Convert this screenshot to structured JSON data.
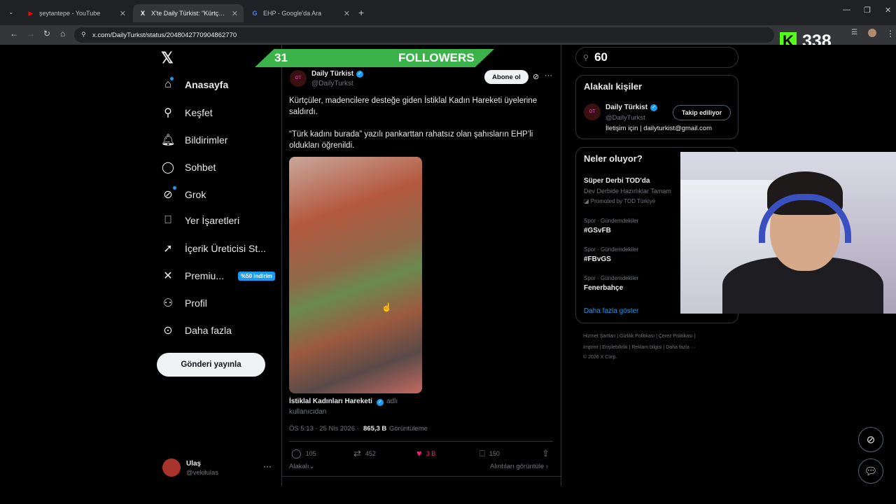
{
  "browser": {
    "tabs": [
      {
        "title": "şeytantepe - YouTube",
        "favicon": "youtube-icon",
        "active": false
      },
      {
        "title": "X'te Daily Türkist: \"Kürtçüler, m",
        "favicon": "x-icon",
        "active": true
      },
      {
        "title": "EHP - Google'da Ara",
        "favicon": "google-icon",
        "active": false
      }
    ],
    "url": "x.com/DailyTurkst/status/2048042770904862770"
  },
  "overlay": {
    "followers_count": "31",
    "followers_label": "FOLLOWERS",
    "kick_viewers": "338",
    "kick_logo_letter": "K"
  },
  "sidebar": {
    "items": [
      {
        "label": "Anasayfa",
        "icon": "home-icon"
      },
      {
        "label": "Keşfet",
        "icon": "search-icon"
      },
      {
        "label": "Bildirimler",
        "icon": "bell-icon"
      },
      {
        "label": "Sohbet",
        "icon": "chat-icon"
      },
      {
        "label": "Grok",
        "icon": "grok-icon"
      },
      {
        "label": "Yer İşaretleri",
        "icon": "bookmark-icon"
      },
      {
        "label": "İçerik Üreticisi St...",
        "icon": "rocket-icon"
      },
      {
        "label": "Premiu...",
        "icon": "x-premium-icon",
        "badge": "%50 indirim"
      },
      {
        "label": "Profil",
        "icon": "person-icon"
      },
      {
        "label": "Daha fazla",
        "icon": "more-circle-icon"
      }
    ],
    "post_button": "Gönderi yayınla",
    "user": {
      "name": "Ulaş",
      "handle": "@vekilulas"
    }
  },
  "tweet": {
    "author_name": "Daily Türkist",
    "author_handle": "@DailyTurkst",
    "subscribe_label": "Abone ol",
    "text_1": "Kürtçüler, madencilere desteğe giden İstiklal Kadın Hareketi üyelerine",
    "text_1b": "saldırdı.",
    "text_2": "“Türk kadını burada” yazılı pankarttan rahatsız olan şahısların EHP’li",
    "text_2b": "oldukları öğrenildi.",
    "source_name": "İstiklal Kadınları Hareketi",
    "source_suffix": "adlı",
    "source_suffix_2": "kullanıcıdan",
    "time": "ÖS 5:13 · 25 Nis 2026 ·",
    "views_count": "865,3 B",
    "views_label": "Görüntüleme",
    "actions": {
      "replies": "105",
      "reposts": "452",
      "likes": "3 B",
      "bookmarks": "150"
    },
    "relevant_label": "Alakalı",
    "quotes_label": "Alıntıları görüntüle"
  },
  "right": {
    "search_value": "60",
    "related_title": "Alakalı kişiler",
    "related_person": {
      "name": "Daily Türkist",
      "handle": "@DailyTurkst",
      "bio": "İletişim için | dailyturkist@gmail.com",
      "button": "Takip ediliyor"
    },
    "trends_title": "Neler oluyor?",
    "promo": {
      "title": "Süper Derbi TOD'da",
      "desc": "Dev Derbide Hazırlıklar Tamam",
      "by": "Promoted by TOD Türkiye"
    },
    "trends": [
      {
        "category": "Spor · Gündemdekiler",
        "name": "#GSvFB"
      },
      {
        "category": "Spor · Gündemdekiler",
        "name": "#FBvGS"
      },
      {
        "category": "Spor · Gündemdekiler",
        "name": "Fenerbahçe"
      }
    ],
    "show_more": "Daha fazla göster",
    "footer_line_1": "Hizmet Şartları  |  Gizlilik Politikası  |  Çerez Politikası  |",
    "footer_line_2": "Imprint  |  Erişilebilirlik  |  Reklam bilgisi  |  Daha fazla ···",
    "footer_line_3": "© 2026 X Corp."
  },
  "colors": {
    "accent": "#1d9bf0",
    "like": "#f91880",
    "followers_bar": "#3cb34a",
    "kick": "#53fc18"
  }
}
